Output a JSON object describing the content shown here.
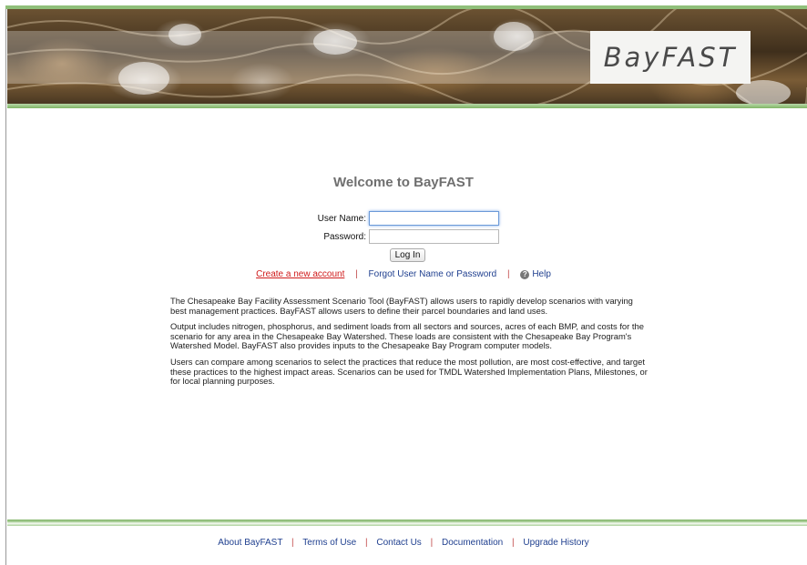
{
  "header": {
    "logo_text": "BayFAST"
  },
  "login": {
    "welcome": "Welcome to BayFAST",
    "username_label": "User Name:",
    "username_value": "",
    "password_label": "Password:",
    "password_value": "",
    "login_button": "Log In"
  },
  "links": {
    "create_account": "Create a new account",
    "forgot": "Forgot User Name or Password",
    "help": "Help",
    "separator": "|"
  },
  "intro": {
    "paragraphs": [
      "The Chesapeake Bay Facility Assessment Scenario Tool (BayFAST) allows users to rapidly develop scenarios with varying best management practices. BayFAST allows users to define their parcel boundaries and land uses.",
      "Output includes nitrogen, phosphorus, and sediment loads from all sectors and sources, acres of each BMP, and costs for the scenario for any area in the Chesapeake Bay Watershed. These loads are consistent with the Chesapeake Bay Program's Watershed Model. BayFAST also provides inputs to the Chesapeake Bay Program computer models.",
      "Users can compare among scenarios to select the practices that reduce the most pollution, are most cost-effective, and target these practices to the highest impact areas. Scenarios can be used for TMDL Watershed Implementation Plans, Milestones, or for local planning purposes."
    ]
  },
  "footer": {
    "links": [
      "About BayFAST",
      "Terms of Use",
      "Contact Us",
      "Documentation",
      "Upgrade History"
    ],
    "separator": "|"
  },
  "colors": {
    "accent_green": "#7fb465",
    "link_blue": "#1f3f8f",
    "link_red": "#d01b1b",
    "welcome_gray": "#6f6f6f"
  },
  "icons": {
    "help": "help-icon"
  }
}
